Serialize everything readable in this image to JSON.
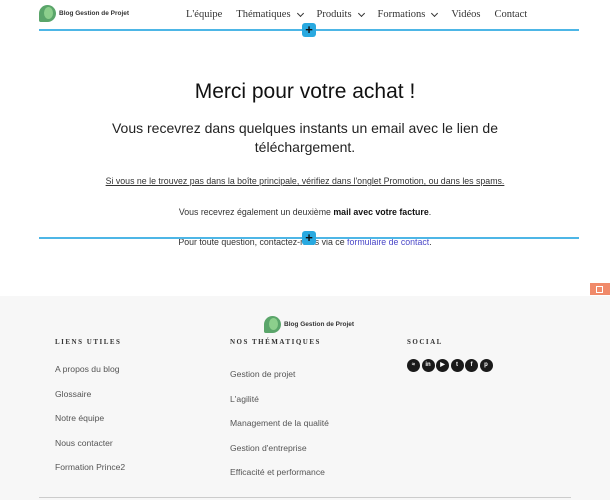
{
  "header": {
    "logo_text": "Blog Gestion de Projet",
    "nav": [
      {
        "label": "L'équipe",
        "dropdown": false
      },
      {
        "label": "Thématiques",
        "dropdown": true
      },
      {
        "label": "Produits",
        "dropdown": true
      },
      {
        "label": "Formations",
        "dropdown": true
      },
      {
        "label": "Vidéos",
        "dropdown": false
      },
      {
        "label": "Contact",
        "dropdown": false
      }
    ]
  },
  "main": {
    "title": "Merci pour votre achat !",
    "subtitle": "Vous recevrez dans quelques instants un email avec le lien de téléchargement.",
    "spam_notice": "Si vous ne le trouvez pas dans la boîte principale, vérifiez dans l'onglet Promotion, ou dans les spams.",
    "invoice_prefix": "Vous recevrez également un deuxième ",
    "invoice_bold": "mail avec votre facture",
    "invoice_suffix": ".",
    "contact_prefix": "Pour toute question, contactez-nous via ce ",
    "contact_link": "formulaire de contact",
    "contact_suffix": "."
  },
  "footer": {
    "logo_text": "Blog Gestion de Projet",
    "col1": {
      "title": "LIENS UTILES",
      "items": [
        "A propos du blog",
        "Glossaire",
        "Notre équipe",
        "Nous contacter",
        "Formation Prince2"
      ]
    },
    "col2": {
      "title": "NOS THÉMATIQUES",
      "items": [
        "Gestion de projet",
        "L'agilité",
        "Management de la qualité",
        "Gestion d'entreprise",
        "Efficacité et performance"
      ]
    },
    "col3": {
      "title": "SOCIAL",
      "icons": [
        "spotify-icon",
        "linkedin-icon",
        "youtube-icon",
        "twitter-icon",
        "facebook-icon",
        "pinterest-icon"
      ]
    }
  },
  "colors": {
    "accent_line": "#4db6e6",
    "plus_button": "#29a9e0",
    "link": "#4a47c8",
    "footer_bg": "#f7f7f7"
  }
}
